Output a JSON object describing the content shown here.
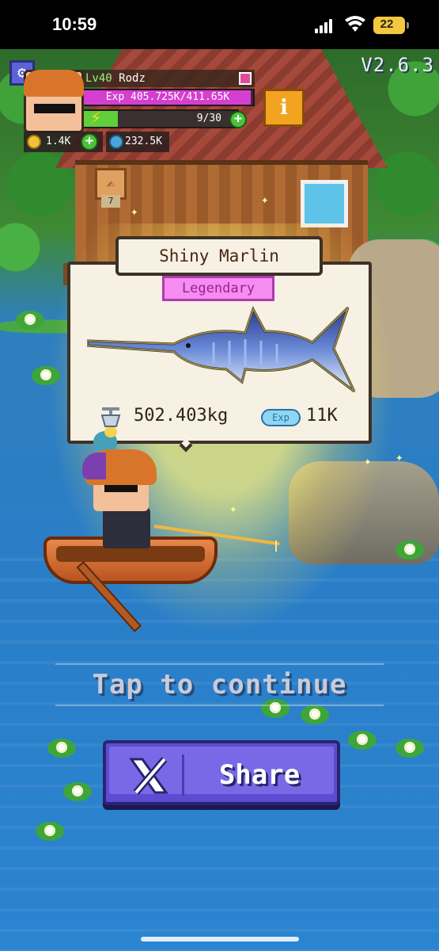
{
  "status_bar": {
    "time": "10:59",
    "battery": "22",
    "battery_color": "#f4c83c"
  },
  "hud": {
    "version": "V2.6.3",
    "player_level_prefix": "Lv",
    "player_level": "40",
    "player_name": "Rodz",
    "exp_text": "Exp 405.725K/411.65K",
    "exp_fraction": 0.986,
    "energy_text": "9/30",
    "energy_fraction": 0.3,
    "coins": "1.4K",
    "gems": "232.5K",
    "info_label": "i",
    "quest_count": "7",
    "icons": [
      "settings-gear-icon",
      "coin-icon",
      "gem-icon",
      "lightning-bolt-icon",
      "plus-icon",
      "info-icon"
    ]
  },
  "catch": {
    "fish_name": "Shiny Marlin",
    "rarity": "Legendary",
    "rarity_color": "#f58cef",
    "weight": "502.403kg",
    "exp_label": "Exp",
    "exp_reward": "11K"
  },
  "prompt": {
    "tap_text": "Tap to continue"
  },
  "share": {
    "label": "Share",
    "icon": "x-logo-icon",
    "color": "#5d4cd1"
  }
}
